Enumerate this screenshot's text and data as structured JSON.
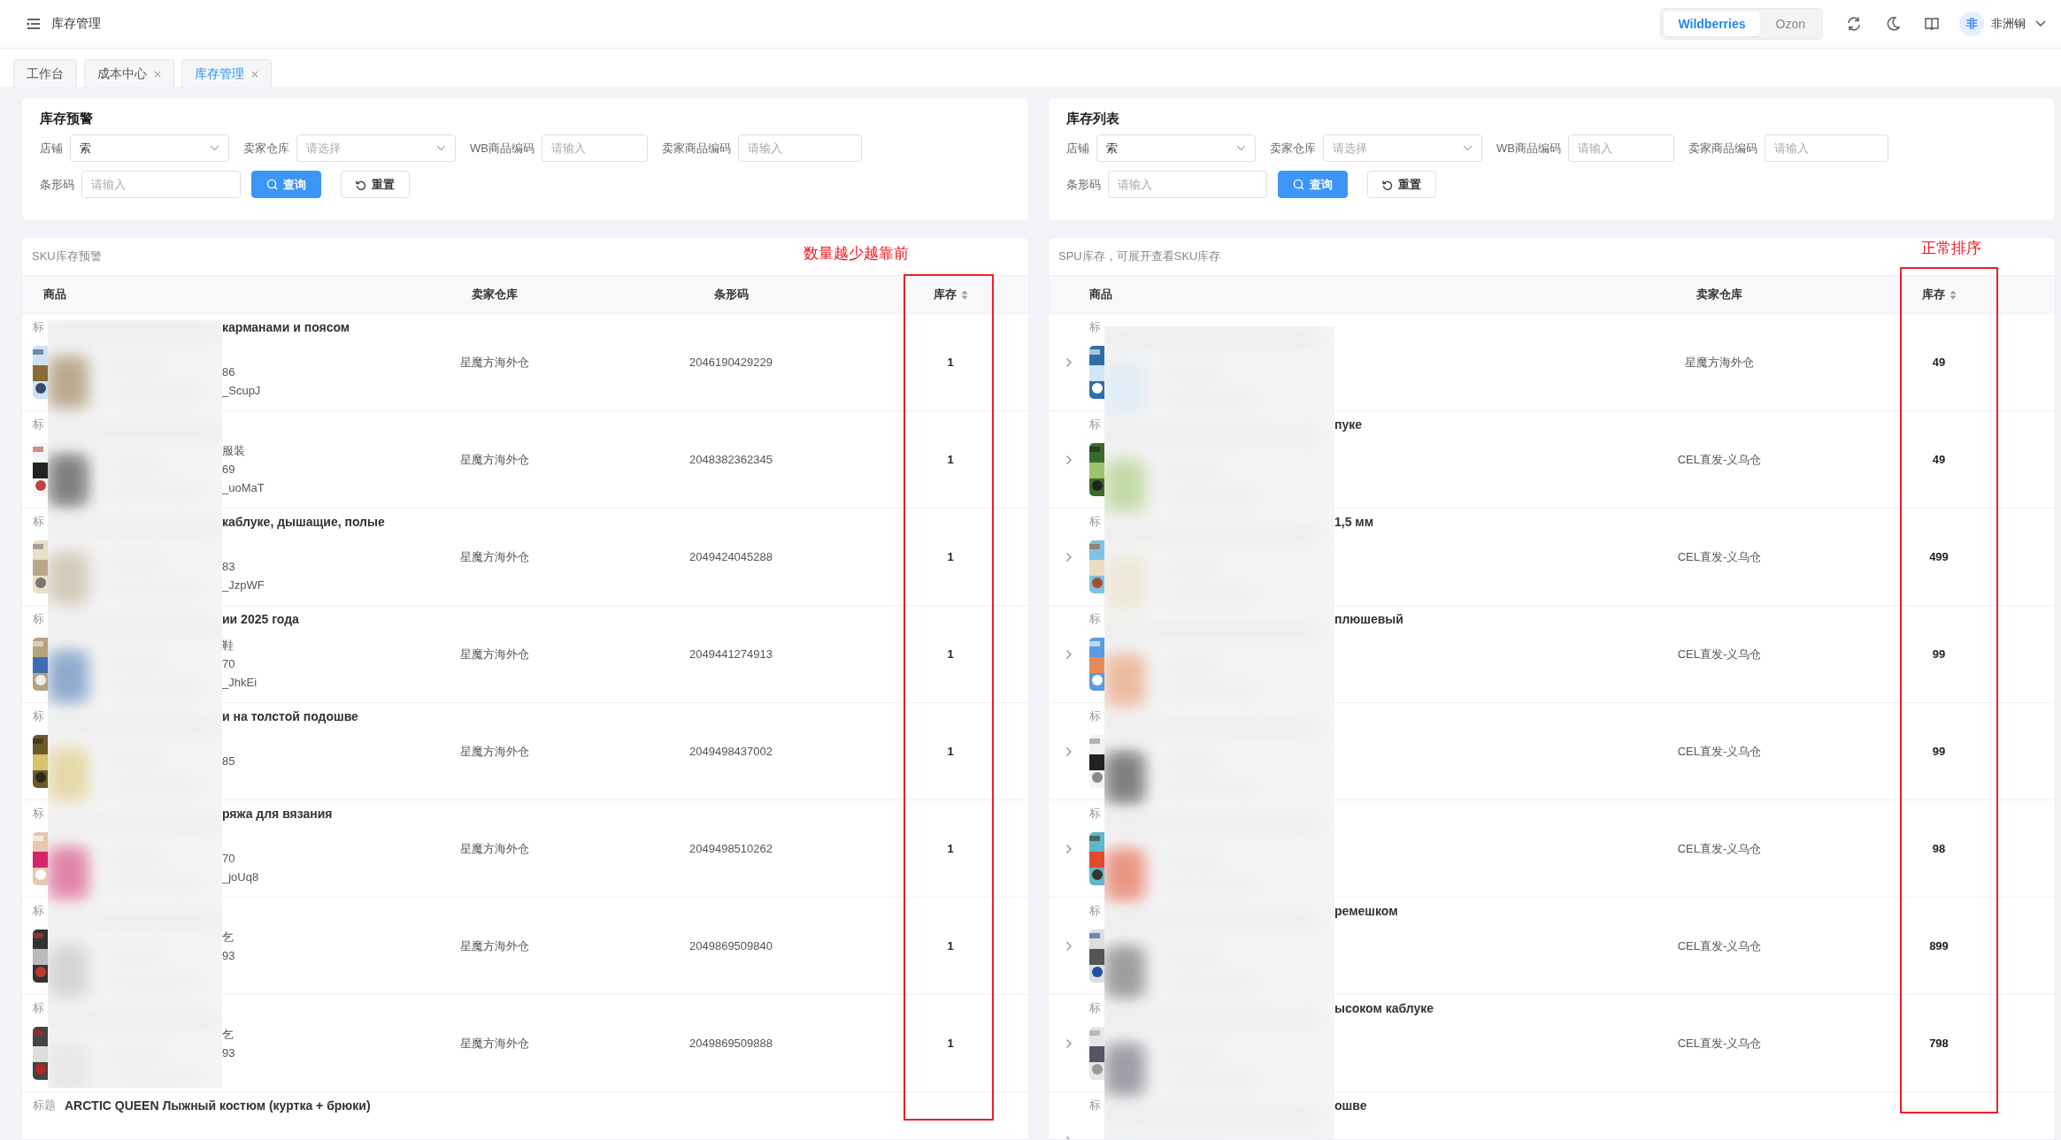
{
  "header": {
    "title": "库存管理",
    "platforms": [
      {
        "label": "Wildberries",
        "selected": true
      },
      {
        "label": "Ozon",
        "selected": false
      }
    ],
    "user": {
      "avatar": "非",
      "name": "非洲铜"
    }
  },
  "tabs": [
    {
      "label": "工作台",
      "closable": false,
      "selected": false
    },
    {
      "label": "成本中心",
      "closable": true,
      "selected": false
    },
    {
      "label": "库存管理",
      "closable": true,
      "selected": true
    }
  ],
  "panels": [
    {
      "filter": {
        "title": "库存预警",
        "fields": [
          {
            "kind": "select",
            "label": "店铺",
            "value": "索"
          },
          {
            "kind": "select",
            "label": "卖家仓库",
            "placeholder": "请选择"
          },
          {
            "kind": "input",
            "label": "WB商品编码",
            "placeholder": "请输入"
          },
          {
            "kind": "input",
            "label": "卖家商品编码",
            "placeholder": "请输入"
          },
          {
            "kind": "input",
            "label": "条形码",
            "placeholder": "请输入"
          }
        ],
        "buttons": [
          {
            "kind": "primary",
            "label": "查询"
          },
          {
            "kind": "default",
            "label": "重置"
          }
        ]
      },
      "table": {
        "caption": "SKU库存预警",
        "columns": [
          {
            "label": "商品"
          },
          {
            "label": "卖家仓库"
          },
          {
            "label": "条形码"
          },
          {
            "label": "库存",
            "sortable": true
          }
        ],
        "rows": [
          {
            "title_label": "标",
            "title": "карманами и поясом",
            "sku": "86",
            "code": "_ScupJ",
            "values": [
              "星魔方海外仓",
              "2046190429229",
              "1"
            ]
          },
          {
            "title_label": "标",
            "category": "服装",
            "sku": "69",
            "code": "_uoMaT",
            "values": [
              "星魔方海外仓",
              "2048382362345",
              "1"
            ]
          },
          {
            "title_label": "标",
            "title": "каблуке, дышащие, полые",
            "sku": "83",
            "code": "_JzpWF",
            "values": [
              "星魔方海外仓",
              "2049424045288",
              "1"
            ]
          },
          {
            "title_label": "标",
            "title": "ии 2025 года",
            "category": "鞋",
            "sku": "70",
            "code": "_JhkEi",
            "values": [
              "星魔方海外仓",
              "2049441274913",
              "1"
            ]
          },
          {
            "title_label": "标",
            "title": "и на толстой подошве",
            "sku": "85",
            "values": [
              "星魔方海外仓",
              "2049498437002",
              "1"
            ]
          },
          {
            "title_label": "标",
            "title": "ряжа для вязания",
            "sku": "70",
            "code": "_joUq8",
            "values": [
              "星魔方海外仓",
              "2049498510262",
              "1"
            ]
          },
          {
            "title_label": "标",
            "category": "乞",
            "sku": "93",
            "values": [
              "星魔方海外仓",
              "2049869509840",
              "1"
            ]
          },
          {
            "title_label": "标",
            "category": "乞",
            "sku": "93",
            "values": [
              "星魔方海外仓",
              "2049869509888",
              "1"
            ]
          },
          {
            "title_label": "标题",
            "title": "ARCTIC QUEEN Лыжный костюм (куртка + брюки)"
          }
        ]
      },
      "annotation": {
        "text": "数量越少越靠前"
      }
    },
    {
      "filter": {
        "title": "库存列表",
        "fields": [
          {
            "kind": "select",
            "label": "店铺",
            "value": "索"
          },
          {
            "kind": "select",
            "label": "卖家仓库",
            "placeholder": "请选择"
          },
          {
            "kind": "input",
            "label": "WB商品编码",
            "placeholder": "请输入"
          },
          {
            "kind": "input",
            "label": "卖家商品编码",
            "placeholder": "请输入"
          },
          {
            "kind": "input",
            "label": "条形码",
            "placeholder": "请输入"
          }
        ],
        "buttons": [
          {
            "kind": "primary",
            "label": "查询"
          },
          {
            "kind": "default",
            "label": "重置"
          }
        ]
      },
      "table": {
        "caption": "SPU库存，可展开查看SKU库存",
        "expandable": true,
        "columns": [
          {
            "label": "商品"
          },
          {
            "label": "卖家仓库"
          },
          {
            "label": "库存",
            "sortable": true
          }
        ],
        "rows": [
          {
            "title_label": "标",
            "values": [
              "星魔方海外仓",
              "49"
            ]
          },
          {
            "title_label": "标",
            "title": "пуке",
            "values": [
              "CEL直发-义乌仓",
              "49"
            ]
          },
          {
            "title_label": "标",
            "title": "1,5 мм",
            "values": [
              "CEL直发-义乌仓",
              "499"
            ]
          },
          {
            "title_label": "标",
            "title": "плюшевый",
            "values": [
              "CEL直发-义乌仓",
              "99"
            ]
          },
          {
            "title_label": "标",
            "values": [
              "CEL直发-义乌仓",
              "99"
            ]
          },
          {
            "title_label": "标",
            "values": [
              "CEL直发-义乌仓",
              "98"
            ]
          },
          {
            "title_label": "标",
            "title": "ремешком",
            "values": [
              "CEL直发-义乌仓",
              "899"
            ]
          },
          {
            "title_label": "标",
            "title": "ысоком каблуке",
            "values": [
              "CEL直发-义乌仓",
              "798"
            ]
          },
          {
            "title_label": "标",
            "title": "ошве"
          }
        ]
      },
      "annotation": {
        "text": "正常排序"
      }
    }
  ]
}
